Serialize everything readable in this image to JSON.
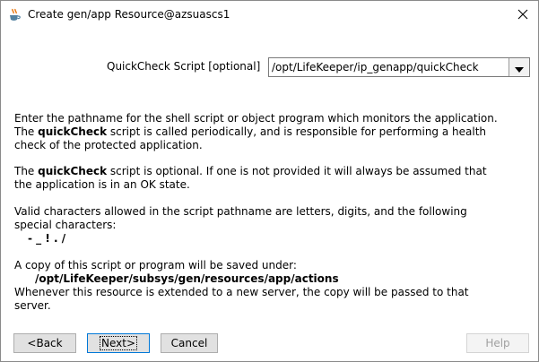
{
  "window": {
    "title": "Create gen/app Resource@azsuascs1",
    "close_glyph": "✕"
  },
  "quickcheck": {
    "label": "QuickCheck Script [optional]",
    "value": "/opt/LifeKeeper/ip_genapp/quickCheck"
  },
  "help": {
    "p1_a": "Enter the pathname for the shell script or object program which monitors the application.",
    "p1_b_pre": "The ",
    "p1_b_bold": "quickCheck",
    "p1_b_post": " script is called periodically, and is responsible for performing a health",
    "p1_c": "check of the protected application.",
    "p2_a_pre": "The ",
    "p2_a_bold": "quickCheck",
    "p2_a_post": " script is optional. If one is not provided it will always be assumed that",
    "p2_b": "the application is in an OK state.",
    "p3_a": "Valid characters allowed in the script pathname are letters, digits, and the following",
    "p3_b": "special characters:",
    "p3_chars": "- _ ! . /",
    "p4_a": "A copy of this script or program will be saved under:",
    "p4_path": "/opt/LifeKeeper/subsys/gen/resources/app/actions",
    "p4_b": "Whenever this resource is extended to a new server, the copy will be passed to that",
    "p4_c": "server."
  },
  "buttons": {
    "back": "<Back",
    "next": "Next>",
    "cancel": "Cancel",
    "help": "Help"
  },
  "icons": {
    "app": "java-cup-icon",
    "close": "close-icon",
    "dropdown": "chevron-down-icon"
  }
}
